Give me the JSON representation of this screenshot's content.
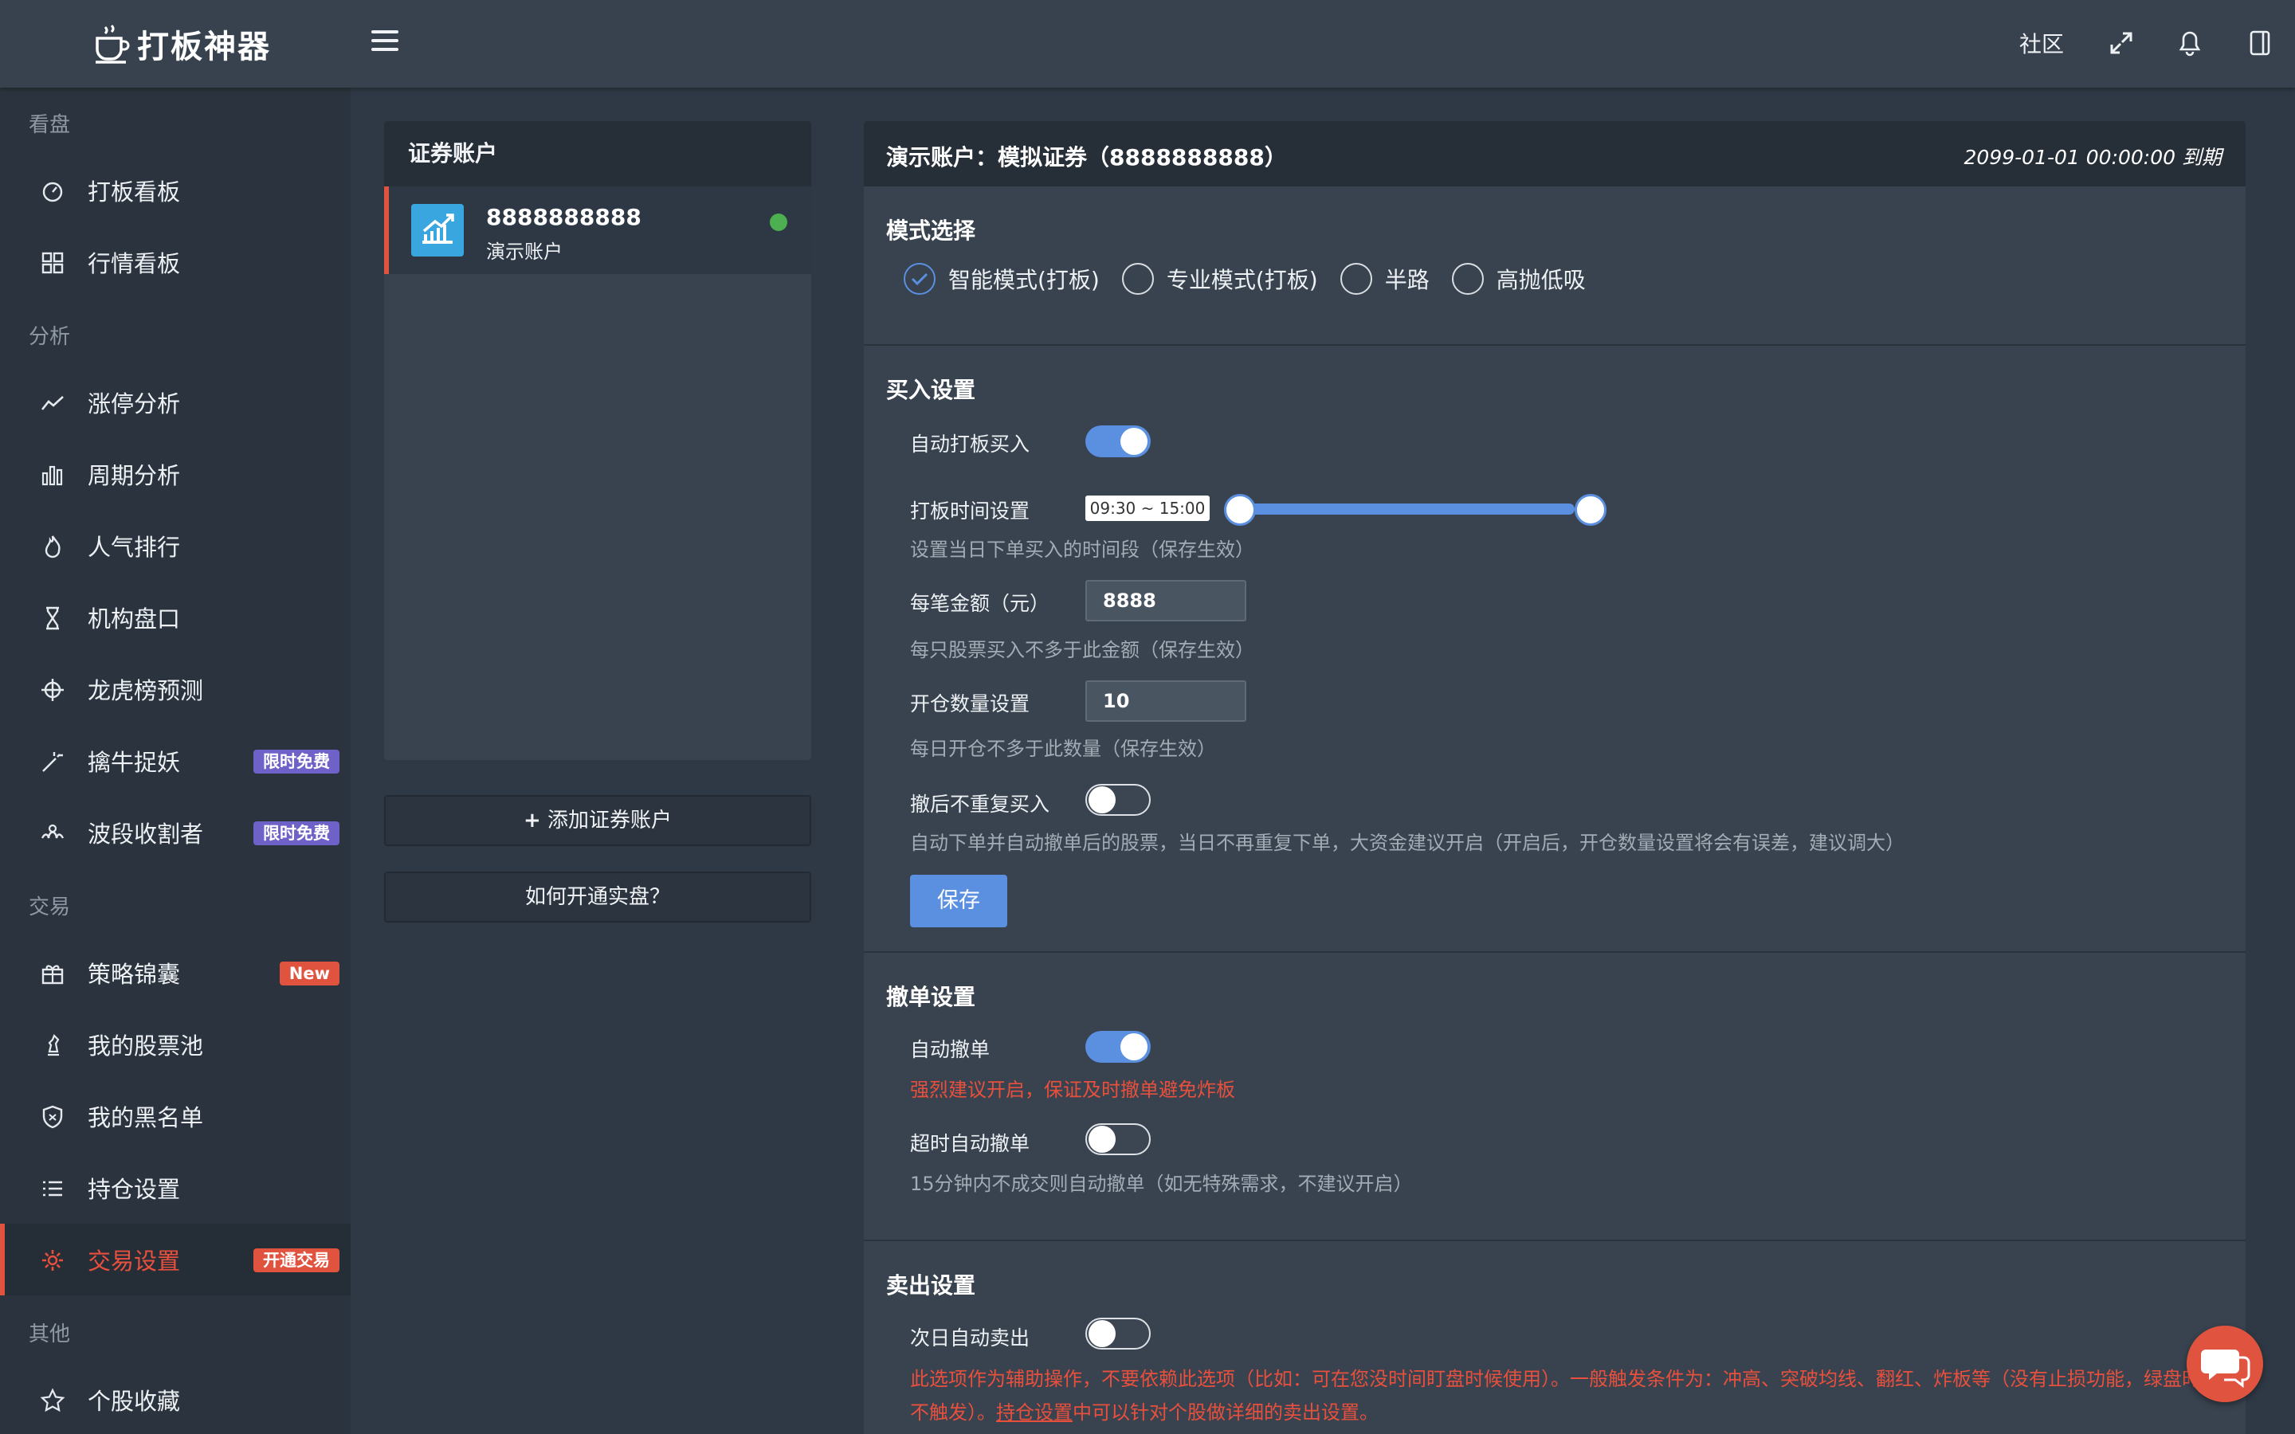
{
  "app": {
    "logo_text": "打板神器"
  },
  "topbar": {
    "community_label": "社区"
  },
  "sidebar": {
    "sections": [
      {
        "title": "看盘"
      },
      {
        "title": "分析"
      },
      {
        "title": "交易"
      },
      {
        "title": "其他"
      }
    ],
    "items": [
      {
        "label": "打板看板",
        "icon": "gauge-icon"
      },
      {
        "label": "行情看板",
        "icon": "grid-icon"
      },
      {
        "label": "涨停分析",
        "icon": "trend-line-icon"
      },
      {
        "label": "周期分析",
        "icon": "bar-chart-icon"
      },
      {
        "label": "人气排行",
        "icon": "flame-icon"
      },
      {
        "label": "机构盘口",
        "icon": "hourglass-icon"
      },
      {
        "label": "龙虎榜预测",
        "icon": "crosshair-icon"
      },
      {
        "label": "擒牛捉妖",
        "icon": "magic-wand-icon",
        "badge": "限时免费"
      },
      {
        "label": "波段收割者",
        "icon": "wave-icon",
        "badge": "限时免费"
      },
      {
        "label": "策略锦囊",
        "icon": "gift-icon",
        "badge": "New"
      },
      {
        "label": "我的股票池",
        "icon": "chess-icon"
      },
      {
        "label": "我的黑名单",
        "icon": "shield-icon"
      },
      {
        "label": "持仓设置",
        "icon": "list-icon"
      },
      {
        "label": "交易设置",
        "icon": "gear-icon",
        "badge": "开通交易",
        "active": true
      },
      {
        "label": "个股收藏",
        "icon": "star-icon"
      }
    ]
  },
  "accounts": {
    "header": "证券账户",
    "items": [
      {
        "number": "8888888888",
        "type": "演示账户",
        "status_color": "#4caf50"
      }
    ],
    "add_button": "添加证券账户",
    "how_button": "如何开通实盘？"
  },
  "main": {
    "title": "演示账户：模拟证券（8888888888）",
    "expire": "2099-01-01 00:00:00  到期",
    "mode": {
      "title": "模式选择",
      "options": [
        "智能模式(打板)",
        "专业模式(打板)",
        "半路",
        "高抛低吸"
      ],
      "selected_index": 0
    },
    "buy": {
      "title": "买入设置",
      "auto_buy_label": "自动打板买入",
      "auto_buy_on": true,
      "time_label": "打板时间设置",
      "time_range": "09:30 ~ 15:00",
      "time_hint": "设置当日下单买入的时间段（保存生效）",
      "amount_label": "每笔金额（元）",
      "amount_value": "8888",
      "amount_hint": "每只股票买入不多于此金额（保存生效）",
      "count_label": "开仓数量设置",
      "count_value": "10",
      "count_hint": "每日开仓不多于此数量（保存生效）",
      "no_rebuy_label": "撤后不重复买入",
      "no_rebuy_on": false,
      "no_rebuy_hint": "自动下单并自动撤单后的股票，当日不再重复下单，大资金建议开启（开启后，开仓数量设置将会有误差，建议调大）",
      "save_label": "保存"
    },
    "cancel": {
      "title": "撤单设置",
      "auto_cancel_label": "自动撤单",
      "auto_cancel_on": true,
      "auto_cancel_hint": "强烈建议开启，保证及时撤单避免炸板",
      "timeout_label": "超时自动撤单",
      "timeout_on": false,
      "timeout_hint": "15分钟内不成交则自动撤单（如无特殊需求，不建议开启）"
    },
    "sell": {
      "title": "卖出设置",
      "next_day_label": "次日自动卖出",
      "next_day_on": false,
      "note_part1": "此选项作为辅助操作，不要依赖此选项（比如：可在您没时间盯盘时候使用）。一般触发条件为：冲高、突破均线、翻红、炸板等（没有止损功能，绿盘时不触发）。",
      "note_link": "持仓设置",
      "note_part2": "中可以针对个股做详细的卖出设置。"
    }
  },
  "colors": {
    "accent": "#5b8fe0",
    "danger": "#e0533f",
    "sidebar_bg": "#2b343e"
  }
}
